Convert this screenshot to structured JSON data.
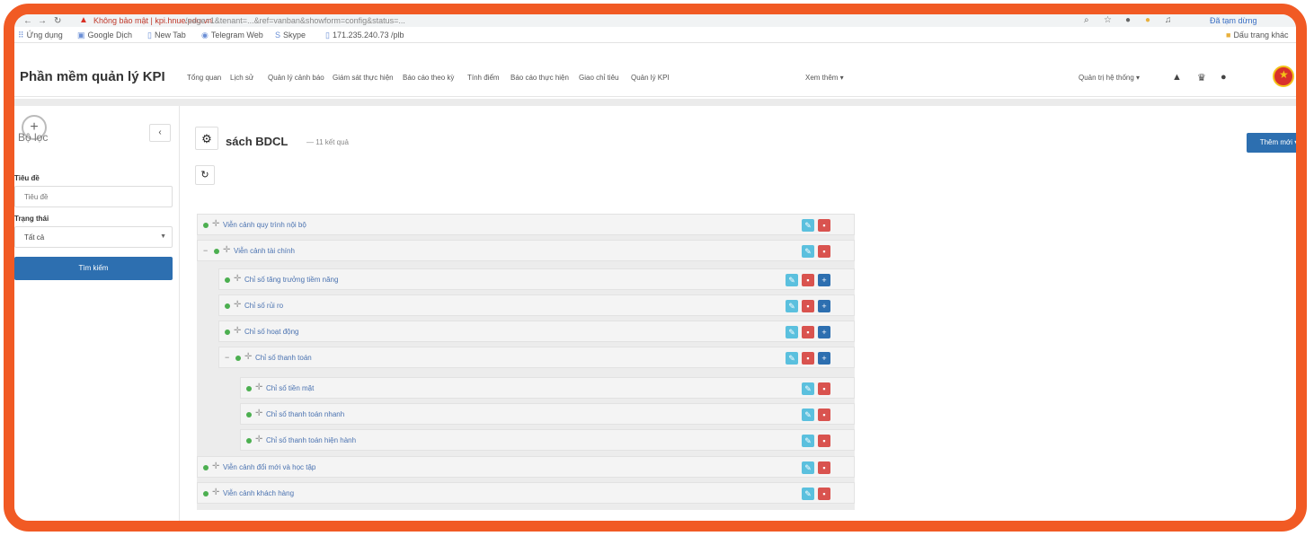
{
  "browser": {
    "warning_label": "Không bảo mật",
    "site": "kpi.hnue.edu.vn",
    "url": "/page=1&tenant=...&ref=vanban&showform=config&status=...",
    "profile": "Đã tạm dừng",
    "bookmarks": [
      {
        "label": "Ứng dụng",
        "icon": "apps-icon"
      },
      {
        "label": "Google Dịch",
        "icon": "translate-icon"
      },
      {
        "label": "New Tab",
        "icon": "page-icon"
      },
      {
        "label": "Telegram Web",
        "icon": "telegram-icon"
      },
      {
        "label": "Skype",
        "icon": "skype-icon"
      },
      {
        "label": "171.235.240.73 /plb",
        "icon": "page-icon"
      }
    ],
    "reading_list": "Dấu trang khác"
  },
  "header": {
    "app_title": "Phần mềm quản lý KPI",
    "menu": [
      "Tổng quan",
      "Lịch sử",
      "Quản lý cảnh báo",
      "Giám sát thực hiện",
      "Báo cáo theo kỳ",
      "Tính điểm",
      "Báo cáo thực hiện",
      "Giao chỉ tiêu",
      "Quản lý KPI"
    ],
    "more": "Xem thêm ▾",
    "admin": "Quản trị hệ thống ▾"
  },
  "sidebar": {
    "heading": "Bộ lọc",
    "collapse": "‹",
    "title_label": "Tiêu đề",
    "title_placeholder": "Tiêu đề",
    "status_label": "Trạng thái",
    "status_value": "Tất cả",
    "search_button": "Tìm kiếm"
  },
  "main": {
    "page_title": "sách BDCL",
    "result_count": "— 11 kết quả",
    "add_more": "Thêm mới ▾"
  },
  "tree": [
    {
      "label": "Viễn cảnh quy trình nội bộ",
      "level": 0,
      "expanded": false
    },
    {
      "label": "Viễn cảnh tài chính",
      "level": 0,
      "expanded": true
    },
    {
      "label": "Chỉ số tăng trưởng tiềm năng",
      "level": 1,
      "expanded": false
    },
    {
      "label": "Chỉ số rủi ro",
      "level": 1,
      "expanded": false
    },
    {
      "label": "Chỉ số hoạt động",
      "level": 1,
      "expanded": false
    },
    {
      "label": "Chỉ số thanh toán",
      "level": 1,
      "expanded": true
    },
    {
      "label": "Chỉ số tiền mặt",
      "level": 2,
      "expanded": false
    },
    {
      "label": "Chỉ số thanh toán nhanh",
      "level": 2,
      "expanded": false
    },
    {
      "label": "Chỉ số thanh toán hiện hành",
      "level": 2,
      "expanded": false
    },
    {
      "label": "Viễn cảnh đổi mới và học tập",
      "level": 0,
      "expanded": false
    },
    {
      "label": "Viễn cảnh khách hàng",
      "level": 0,
      "expanded": false
    }
  ],
  "colors": {
    "accent": "#2d6fb0",
    "frame": "#f15a24",
    "edit": "#5bc0de",
    "delete": "#d9534f"
  }
}
